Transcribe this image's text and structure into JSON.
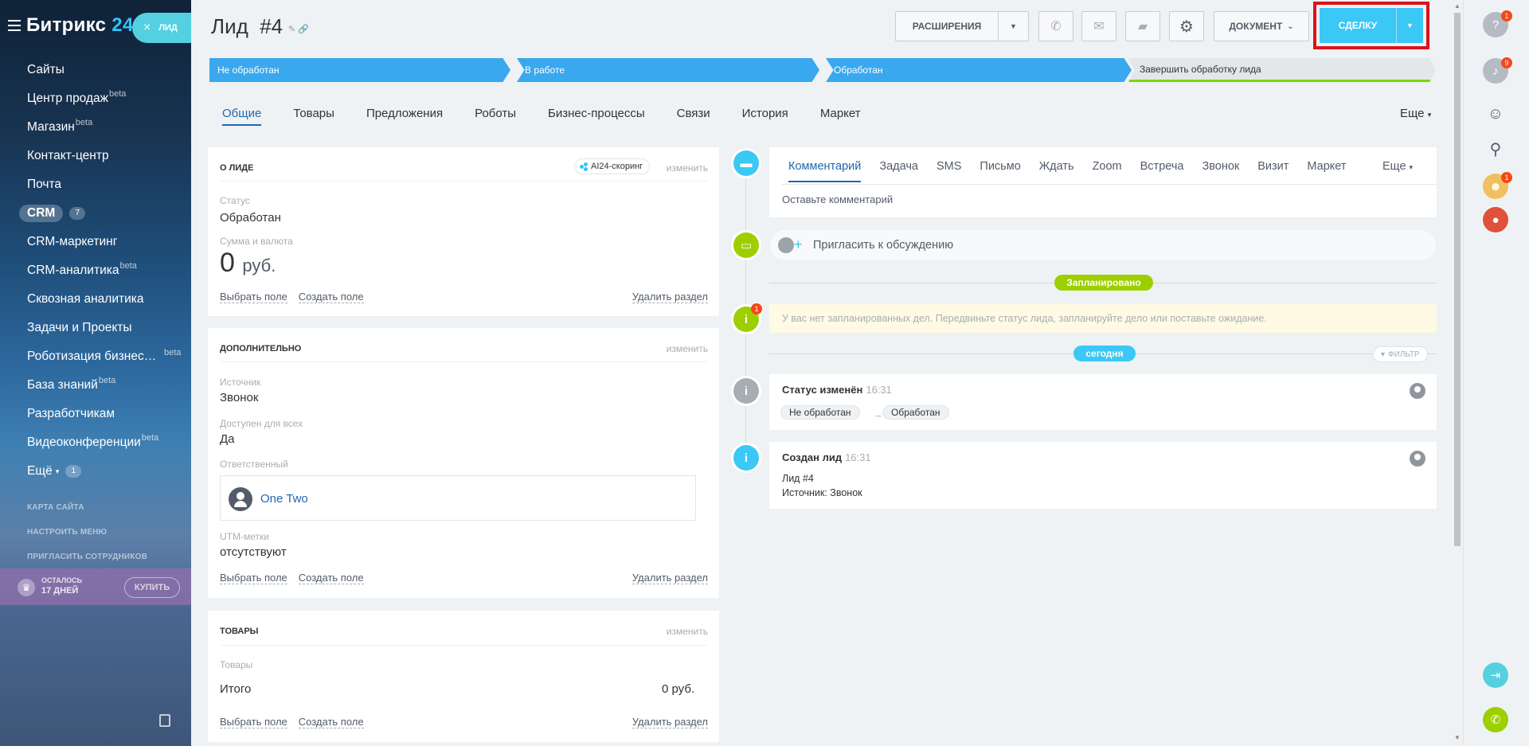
{
  "sidebar": {
    "brand_name": "Битрикс",
    "brand_num": "24",
    "lead_pill": {
      "close": "×",
      "label": "ЛИД"
    },
    "items": [
      {
        "label": "Сайты",
        "sup": ""
      },
      {
        "label": "Центр продаж",
        "sup": "beta"
      },
      {
        "label": "Магазин",
        "sup": "beta"
      },
      {
        "label": "Контакт-центр",
        "sup": ""
      },
      {
        "label": "Почта",
        "sup": ""
      },
      {
        "label": "CRM",
        "counter": "7"
      },
      {
        "label": "CRM-маркетинг",
        "sup": ""
      },
      {
        "label": "CRM-аналитика",
        "sup": "beta"
      },
      {
        "label": "Сквозная аналитика",
        "sup": ""
      },
      {
        "label": "Задачи и Проекты",
        "sup": ""
      },
      {
        "label": "Роботизация бизнес…",
        "sup": "beta"
      },
      {
        "label": "База знаний",
        "sup": "beta"
      },
      {
        "label": "Разработчикам",
        "sup": ""
      },
      {
        "label": "Видеоконференции",
        "sup": "beta"
      },
      {
        "label": "Ещё",
        "counter": "1"
      }
    ],
    "small_links": [
      "КАРТА САЙТА",
      "НАСТРОИТЬ МЕНЮ",
      "ПРИГЛАСИТЬ СОТРУДНИКОВ"
    ],
    "trial": {
      "line1": "ОСТАЛОСЬ",
      "line2": "17 ДНЕЙ",
      "buy": "КУПИТЬ"
    }
  },
  "header": {
    "title": "Лид  #4",
    "title_icons": "✎ 🔗",
    "extensions": "РАСШИРЕНИЯ",
    "document": "ДОКУМЕНТ",
    "deal_button": "СДЕЛКУ"
  },
  "stages": [
    "Не обработан",
    "В работе",
    "Обработан",
    "Завершить обработку лида"
  ],
  "tabs": [
    "Общие",
    "Товары",
    "Предложения",
    "Роботы",
    "Бизнес-процессы",
    "Связи",
    "История",
    "Маркет"
  ],
  "tabs_more": "Еще",
  "about_lead": {
    "title": "О ЛИДЕ",
    "ai_scoring": "AI24-скоринг",
    "edit": "изменить",
    "status_label": "Статус",
    "status_value": "Обработан",
    "sum_label": "Сумма и валюта",
    "sum_value": "0",
    "currency": "руб.",
    "select_field": "Выбрать поле",
    "create_field": "Создать поле",
    "delete_section": "Удалить раздел"
  },
  "additional": {
    "title": "ДОПОЛНИТЕЛЬНО",
    "edit": "изменить",
    "source_label": "Источник",
    "source_value": "Звонок",
    "available_label": "Доступен для всех",
    "available_value": "Да",
    "responsible_label": "Ответственный",
    "responsible_name": "One Two",
    "utm_label": "UTM-метки",
    "utm_value": "отсутствуют",
    "select_field": "Выбрать поле",
    "create_field": "Создать поле",
    "delete_section": "Удалить раздел"
  },
  "products": {
    "title": "ТОВАРЫ",
    "edit": "изменить",
    "products_label": "Товары",
    "total_label": "Итого",
    "total_value": "0 руб.",
    "select_field": "Выбрать поле",
    "create_field": "Создать поле",
    "delete_section": "Удалить раздел"
  },
  "timeline": {
    "editor_tabs": [
      "Комментарий",
      "Задача",
      "SMS",
      "Письмо",
      "Ждать",
      "Zoom",
      "Встреча",
      "Звонок",
      "Визит",
      "Маркет"
    ],
    "editor_more": "Еще",
    "editor_placeholder": "Оставьте комментарий",
    "invite": "Пригласить к обсуждению",
    "planned": "Запланировано",
    "warning_badge": "1",
    "warning_text": "У вас нет запланированных дел. Передвиньте статус лида, запланируйте дело или поставьте ожидание.",
    "today": "сегодня",
    "filter": "ФИЛЬТР",
    "events": [
      {
        "title": "Статус изменён",
        "time": "16:31",
        "from": "Не обработан",
        "to": "Обработан"
      },
      {
        "title": "Создан лид",
        "time": "16:31",
        "line1": "Лид #4",
        "line2": "Источник: Звонок"
      }
    ]
  },
  "rail": {
    "help_badge": "1",
    "bell_badge": "9",
    "avatar_badge": "1"
  },
  "colors": {
    "accent": "#3bc8f5",
    "stage": "#39a8ef",
    "link": "#2067b0",
    "green": "#9dcf00",
    "highlight": "#e0101a"
  }
}
